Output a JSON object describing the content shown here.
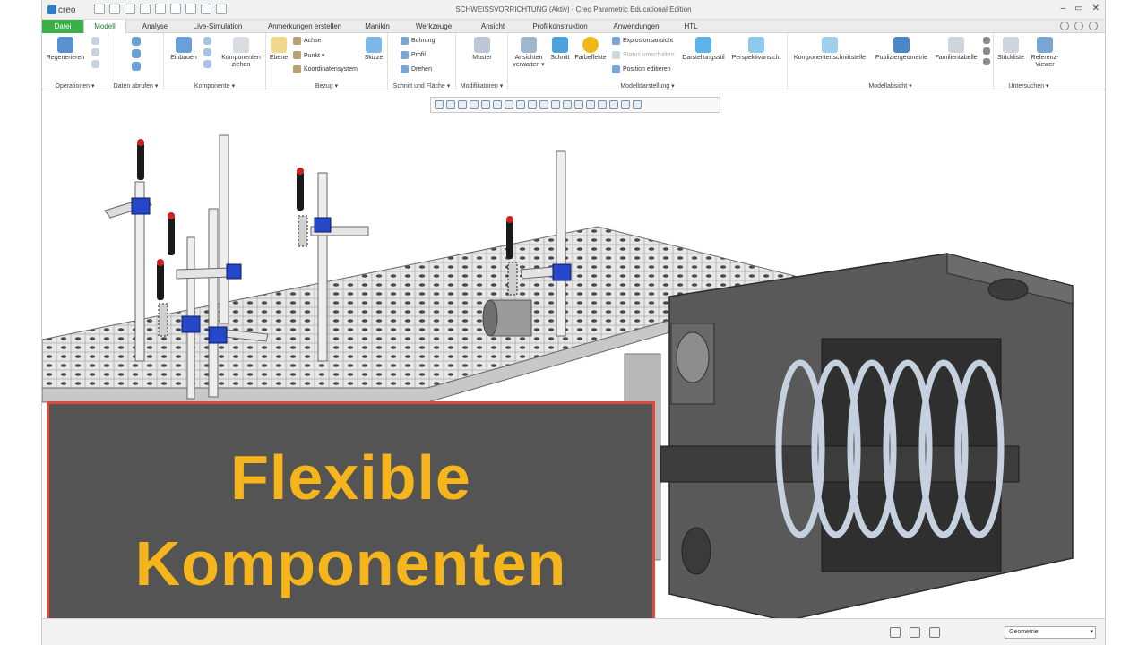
{
  "app": {
    "logo": "creo",
    "window_title": "SCHWEISSVORRICHTUNG (Aktiv) - Creo Parametric Educational Edition",
    "window_controls": [
      "–",
      "▭",
      "✕"
    ]
  },
  "tabs": [
    {
      "label": "Datei"
    },
    {
      "label": "Modell"
    },
    {
      "label": "Analyse"
    },
    {
      "label": "Live-Simulation"
    },
    {
      "label": "Anmerkungen erstellen"
    },
    {
      "label": "Manikin"
    },
    {
      "label": "Werkzeuge"
    },
    {
      "label": "Ansicht"
    },
    {
      "label": "Profilkonstruktion"
    },
    {
      "label": "Anwendungen"
    },
    {
      "label": "HTL"
    }
  ],
  "ribbon": {
    "operationen": {
      "label": "Operationen ▾",
      "regen": "Regenerieren"
    },
    "daten": {
      "label": "Daten abrufen ▾"
    },
    "komponente": {
      "label": "Komponente ▾",
      "einbauen": "Einbauen",
      "ziehen": "Komponenten ziehen"
    },
    "bezug": {
      "label": "Bezug ▾",
      "ebene": "Ebene",
      "achse": "Achse",
      "punkt": "Punkt ▾",
      "koord": "Koordinatensystem",
      "skizze": "Skizze"
    },
    "schnitt": {
      "label": "Schnitt und Fläche ▾",
      "bohrung": "Bohrung",
      "profil": "Profil",
      "drehen": "Drehen"
    },
    "modifikatoren": {
      "label": "Modifikatoren ▾",
      "muster": "Muster"
    },
    "modelldarstellung": {
      "label": "Modelldarstellung ▾",
      "ansichten": "Ansichten verwalten ▾",
      "schnitt": "Schnitt",
      "farbeffekte": "Farbeffekte",
      "explosion": "Explosionsansicht",
      "status": "Status umschalten",
      "position": "Position editieren",
      "darstellungsstil": "Darstellungsstil",
      "perspektive": "Perspektivansicht"
    },
    "modellabsicht": {
      "label": "Modellabsicht ▾",
      "schnittstelle": "Komponentenschnittstelle",
      "publizier": "Publiziergeometrie",
      "familie": "Familientabelle"
    },
    "untersuchen": {
      "label": "Untersuchen ▾",
      "stueckliste": "Stückliste",
      "referenz": "Referenz-Viewer"
    }
  },
  "banner": {
    "line1": "Flexible",
    "line2": "Komponenten"
  },
  "statusbar": {
    "filter": "Geometrie"
  },
  "colors": {
    "file_tab": "#38b045",
    "banner_bg": "#545454",
    "banner_border": "#d94b3f",
    "banner_text": "#f5b51b"
  }
}
